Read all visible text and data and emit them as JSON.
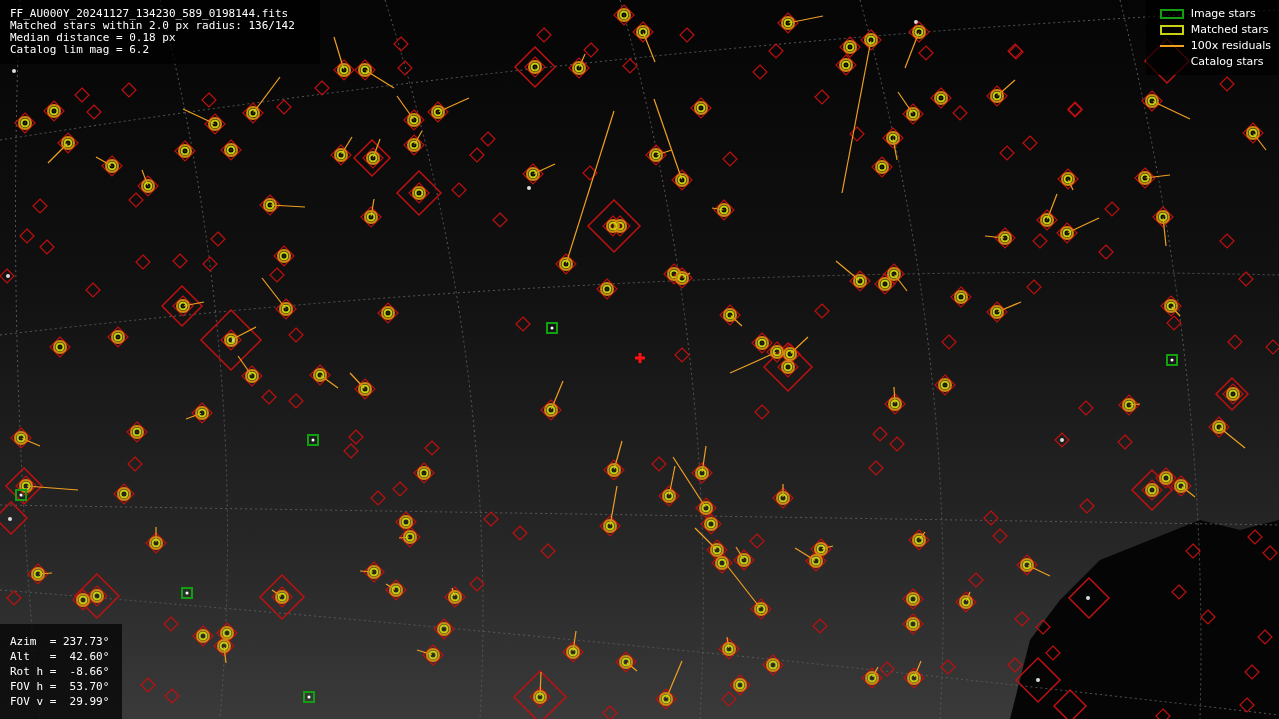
{
  "info": {
    "filename": "FF_AU000Y_20241127_134230_589_0198144.fits",
    "lines": [
      "Matched stars within 2.0 px radius: 136/142",
      "Median distance = 0.18 px",
      "Catalog lim mag = 6.2"
    ]
  },
  "legend": [
    {
      "kind": "image",
      "label": "Image stars"
    },
    {
      "kind": "matched",
      "label": "Matched stars"
    },
    {
      "kind": "residual",
      "label": "100x residuals"
    },
    {
      "kind": "catalog",
      "label": "Catalog stars"
    }
  ],
  "pointing": [
    "Azim  = 237.73°",
    "Alt   =  42.60°",
    "Rot h =  -8.66°",
    "FOV h =  53.70°",
    "FOV v =  29.99°"
  ]
}
